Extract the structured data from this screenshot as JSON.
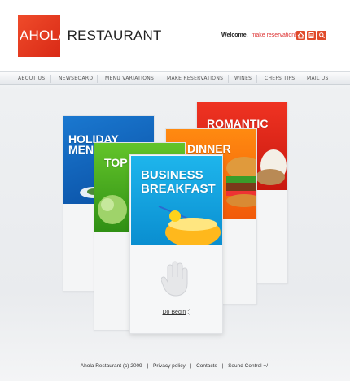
{
  "brand": {
    "logo_left": "AHOLA",
    "logo_right": "RESTAURANT",
    "accent": "#e0391f"
  },
  "header": {
    "welcome": "Welcome,",
    "reservation_link": "make reservation!",
    "icons": [
      "home-icon",
      "page-icon",
      "search-icon"
    ]
  },
  "nav": {
    "items": [
      "ABOUT US",
      "NEWSBOARD",
      "MENU VARIATIONS",
      "MAKE RESERVATIONS",
      "WINES",
      "CHEFS TIPS",
      "MAIL US"
    ]
  },
  "cards": {
    "holiday": "HOLIDAY MENU",
    "romantic": "ROMANTIC",
    "dinner": "DINNER",
    "top": "TOP MENU",
    "business_1": "BUSINESS",
    "business_2": "BREAKFAST"
  },
  "cta": {
    "link": "Do Begin",
    "smiley": ":)"
  },
  "footer": {
    "copyright": "Ahola Restaurant (c) 2009",
    "privacy": "Privacy policy",
    "contacts": "Contacts",
    "sound": "Sound Control +/-",
    "sep": "|"
  }
}
